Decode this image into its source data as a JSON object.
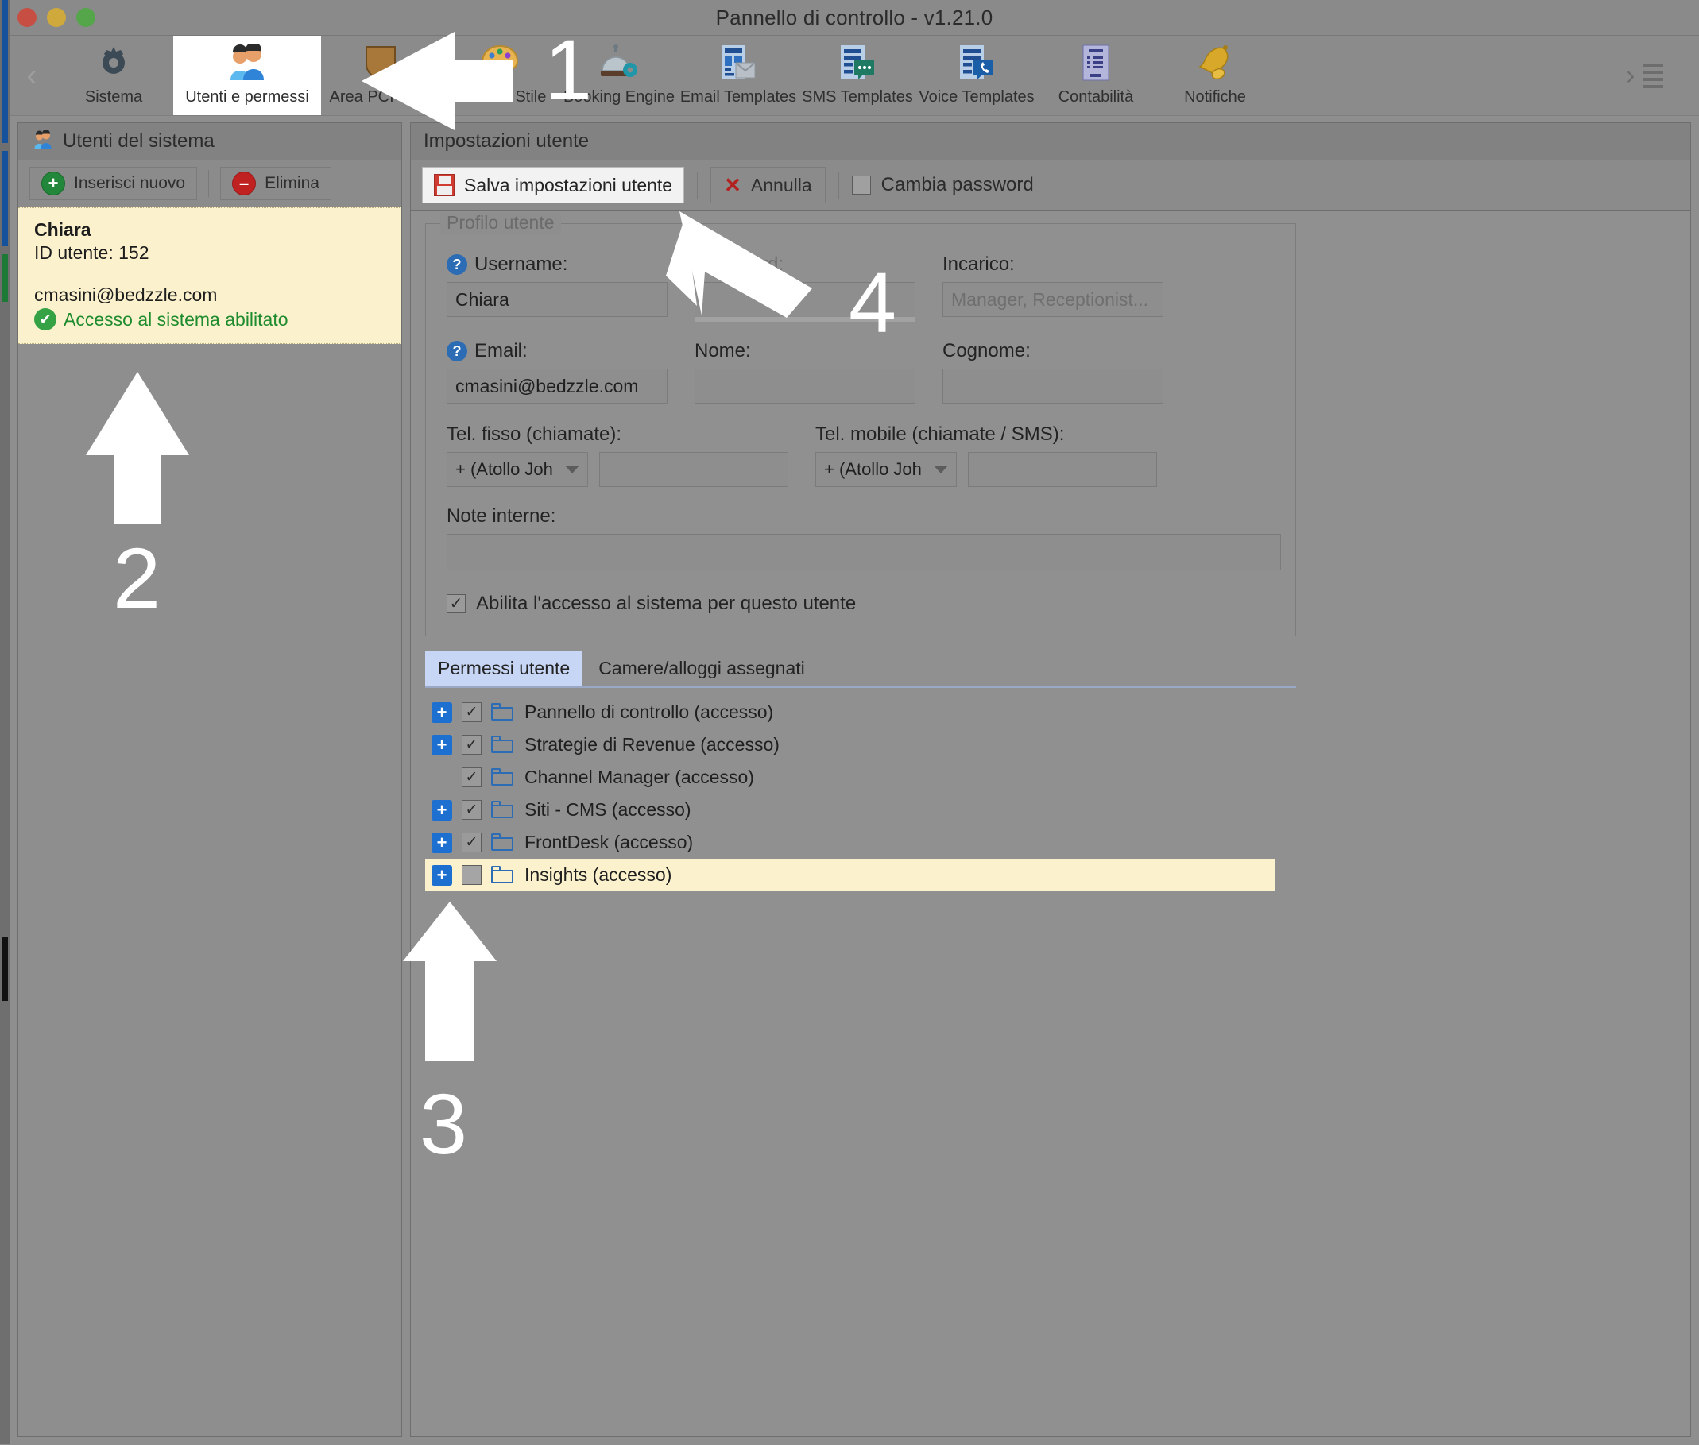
{
  "window": {
    "title": "Pannello di controllo - v1.21.0",
    "traffic_lights": [
      "close-button",
      "minimize-button",
      "maximize-button"
    ]
  },
  "toolbar": {
    "back_icon": "chevron-left-icon",
    "overflow_icon": "chevron-right-icon",
    "menu_icon": "hamburger-menu-icon",
    "items": [
      {
        "label": "Sistema",
        "icon": "gear-icon",
        "active": false
      },
      {
        "label": "Utenti e permessi",
        "icon": "users-icon",
        "active": true
      },
      {
        "label": "Area PCI-DSS",
        "icon": "shield-icon",
        "active": false
      },
      {
        "label": "Brand & Stile",
        "icon": "palette-icon",
        "active": false
      },
      {
        "label": "Booking Engine",
        "icon": "bell-desk-gear-icon",
        "active": false
      },
      {
        "label": "Email Templates",
        "icon": "email-template-icon",
        "active": false
      },
      {
        "label": "SMS Templates",
        "icon": "sms-template-icon",
        "active": false
      },
      {
        "label": "Voice Templates",
        "icon": "voice-template-icon",
        "active": false
      },
      {
        "label": "Contabilità",
        "icon": "invoice-icon",
        "active": false
      },
      {
        "label": "Notifiche",
        "icon": "bell-icon",
        "active": false
      }
    ]
  },
  "left_panel": {
    "header_title": "Utenti del sistema",
    "header_icon": "users-icon",
    "buttons": {
      "add_label": "Inserisci nuovo",
      "add_icon": "plus-circle-icon",
      "delete_label": "Elimina",
      "delete_icon": "minus-circle-icon"
    },
    "user_card": {
      "name": "Chiara",
      "id_line": "ID utente: 152",
      "email": "cmasini@bedzzle.com",
      "status": "Accesso al sistema abilitato",
      "status_icon": "check-circle-icon",
      "status_color": "#1d8b2e",
      "background": "#fbf2cd"
    }
  },
  "right_panel": {
    "header_title": "Impostazioni utente",
    "toolbar": {
      "save_label": "Salva impostazioni utente",
      "save_icon": "floppy-disk-icon",
      "cancel_label": "Annulla",
      "cancel_icon": "red-x-icon",
      "change_password_label": "Cambia password",
      "change_password_checked": false
    },
    "profile": {
      "legend": "Profilo utente",
      "username_label": "Username:",
      "username_value": "Chiara",
      "username_help_icon": "help-icon",
      "password_label": "Password:",
      "password_value": "",
      "password_disabled": true,
      "incarico_label": "Incarico:",
      "incarico_placeholder": "Manager, Receptionist...",
      "incarico_value": "",
      "email_label": "Email:",
      "email_value": "cmasini@bedzzle.com",
      "email_help_icon": "help-icon",
      "nome_label": "Nome:",
      "nome_value": "",
      "cognome_label": "Cognome:",
      "cognome_value": "",
      "tel_fisso_label": "Tel. fisso (chiamate):",
      "tel_fisso_prefix": "+ (Atollo Joh",
      "tel_fisso_value": "",
      "tel_mobile_label": "Tel. mobile (chiamate / SMS):",
      "tel_mobile_prefix": "+ (Atollo Joh",
      "tel_mobile_value": "",
      "note_label": "Note interne:",
      "note_value": "",
      "enable_access_label": "Abilita l'accesso al sistema per questo utente",
      "enable_access_checked": true
    },
    "tabs": [
      {
        "label": "Permessi utente",
        "active": true
      },
      {
        "label": "Camere/alloggi assegnati",
        "active": false
      }
    ],
    "permissions": [
      {
        "label": "Pannello di controllo (accesso)",
        "expandable": true,
        "checked": true,
        "selected": false
      },
      {
        "label": "Strategie di Revenue (accesso)",
        "expandable": true,
        "checked": true,
        "selected": false
      },
      {
        "label": "Channel Manager (accesso)",
        "expandable": false,
        "checked": true,
        "selected": false
      },
      {
        "label": "Siti - CMS (accesso)",
        "expandable": true,
        "checked": true,
        "selected": false
      },
      {
        "label": "FrontDesk (accesso)",
        "expandable": true,
        "checked": true,
        "selected": false
      },
      {
        "label": "Insights (accesso)",
        "expandable": true,
        "checked": false,
        "selected": true
      }
    ]
  },
  "annotations": {
    "step1": "1",
    "step2": "2",
    "step3": "3",
    "step4": "4",
    "color": "#ffffff"
  }
}
